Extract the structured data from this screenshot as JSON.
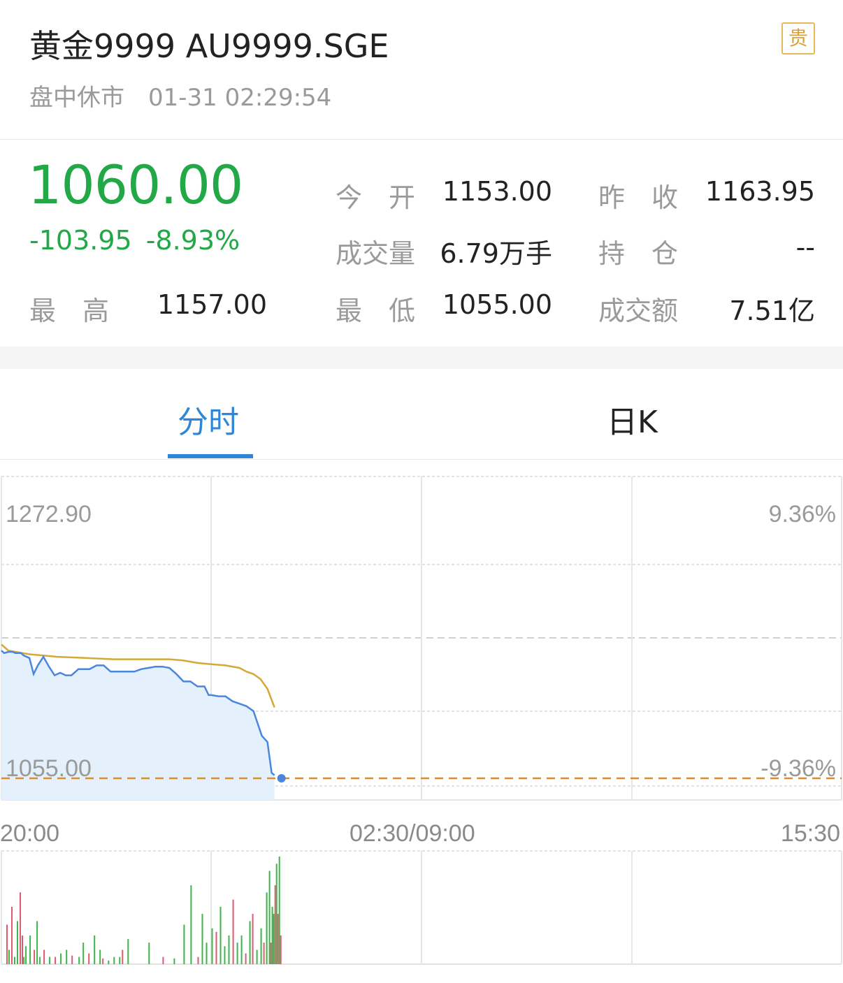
{
  "header": {
    "title": "黄金9999 AU9999.SGE",
    "status": "盘中休市",
    "datetime": "01-31 02:29:54",
    "badge": "贵"
  },
  "quote": {
    "price": "1060.00",
    "change": "-103.95",
    "change_pct": "-8.93%",
    "high_label": "最　高",
    "high": "1157.00",
    "open_label": "今　开",
    "open": "1153.00",
    "volume_label": "成交量",
    "volume": "6.79万手",
    "low_label": "最　低",
    "low": "1055.00",
    "prev_close_label": "昨　收",
    "prev_close": "1163.95",
    "position_label": "持　仓",
    "position": "--",
    "turnover_label": "成交额",
    "turnover": "7.51亿",
    "up_color": "#22a847"
  },
  "tabs": [
    {
      "label": "分时",
      "active": true
    },
    {
      "label": "日K",
      "active": false
    }
  ],
  "colors": {
    "price_line": "#4a86e0",
    "avg_line": "#d4a935",
    "area_fill": "#e4f1fd",
    "dashed_low": "#e08a2a",
    "vol_up": "#e05a6e",
    "vol_down": "#3db54a"
  },
  "chart_data": {
    "type": "line",
    "title": "",
    "y_axis_left": {
      "max_label": "1272.90",
      "min_label": "1055.00"
    },
    "y_axis_right": {
      "max_label": "9.36%",
      "min_label": "-9.36%"
    },
    "ylim": [
      1055.0,
      1272.9
    ],
    "prev_close": 1163.95,
    "x_labels": [
      "20:00",
      "02:30/09:00",
      "15:30"
    ],
    "price_series": {
      "name": "",
      "x": [
        0,
        0.2,
        0.5,
        0.8,
        1.0,
        1.4,
        1.6,
        2.0,
        2.3,
        2.6,
        3.0,
        3.4,
        3.8,
        4.2,
        4.6,
        5.0,
        5.5,
        6.0,
        6.3,
        6.8,
        7.3,
        7.8,
        8.0,
        8.5,
        9.0,
        9.5,
        10.0,
        10.5,
        11.0,
        11.5,
        12.0,
        12.5,
        13.0,
        13.5,
        14.0,
        14.5,
        14.8,
        15.0,
        15.5,
        16.0,
        16.5,
        17.0,
        17.5,
        18.0,
        18.3,
        18.6,
        19.0,
        19.3,
        19.5
      ],
      "values": [
        1159,
        1157,
        1158,
        1158,
        1157,
        1157,
        1155,
        1153,
        1140,
        1147,
        1154,
        1146,
        1139,
        1141,
        1139,
        1139,
        1144,
        1144,
        1144,
        1147,
        1147,
        1142,
        1142,
        1142,
        1142,
        1142,
        1144,
        1145,
        1146,
        1146,
        1145,
        1140,
        1134,
        1134,
        1130,
        1130,
        1123,
        1123,
        1122,
        1122,
        1118,
        1116,
        1114,
        1110,
        1100,
        1090,
        1085,
        1060,
        1058
      ]
    },
    "avg_series": {
      "name": "",
      "x": [
        0,
        0.5,
        1.0,
        2.0,
        3.0,
        4.0,
        6.0,
        8.0,
        10.0,
        12.0,
        13.0,
        14.0,
        15.0,
        16.0,
        17.0,
        17.5,
        18.0,
        18.5,
        19.0,
        19.5
      ],
      "values": [
        1163.95,
        1159,
        1158,
        1156,
        1155,
        1154,
        1153,
        1152,
        1152,
        1152,
        1151,
        1149,
        1148,
        1147,
        1145,
        1142,
        1140,
        1136,
        1128,
        1113
      ]
    },
    "volume_bars": {
      "x": [
        0.35,
        0.5,
        0.7,
        0.9,
        1.1,
        1.3,
        1.45,
        1.55,
        1.7,
        2.0,
        2.3,
        2.5,
        2.7,
        3.0,
        3.4,
        3.8,
        4.2,
        4.6,
        5.0,
        5.5,
        5.8,
        6.2,
        6.6,
        7.0,
        7.2,
        7.6,
        8.0,
        8.4,
        8.6,
        9.0,
        10.5,
        11.5,
        12.3,
        13.0,
        13.5,
        14.0,
        14.3,
        14.6,
        15.0,
        15.3,
        15.6,
        15.9,
        16.2,
        16.5,
        16.8,
        17.1,
        17.4,
        17.7,
        17.9,
        18.2,
        18.5,
        18.7,
        18.9,
        19.1,
        19.2,
        19.3,
        19.4,
        19.5,
        19.6,
        19.7,
        19.8,
        19.9
      ],
      "values": [
        55,
        20,
        80,
        10,
        60,
        100,
        40,
        10,
        25,
        40,
        20,
        60,
        10,
        20,
        10,
        10,
        15,
        20,
        12,
        10,
        30,
        15,
        40,
        20,
        8,
        5,
        10,
        10,
        20,
        35,
        30,
        10,
        8,
        55,
        110,
        10,
        70,
        30,
        50,
        45,
        80,
        25,
        40,
        90,
        30,
        40,
        15,
        60,
        70,
        20,
        50,
        30,
        100,
        130,
        30,
        80,
        70,
        110,
        140,
        70,
        150,
        40
      ],
      "up": [
        true,
        false,
        true,
        false,
        false,
        true,
        true,
        false,
        false,
        false,
        true,
        false,
        false,
        true,
        false,
        true,
        false,
        false,
        true,
        false,
        false,
        true,
        false,
        false,
        true,
        false,
        false,
        false,
        true,
        false,
        false,
        true,
        false,
        false,
        false,
        true,
        false,
        false,
        false,
        true,
        false,
        false,
        false,
        true,
        false,
        false,
        true,
        false,
        true,
        false,
        false,
        true,
        false,
        false,
        true,
        false,
        false,
        true,
        false,
        true,
        false,
        true
      ]
    }
  }
}
